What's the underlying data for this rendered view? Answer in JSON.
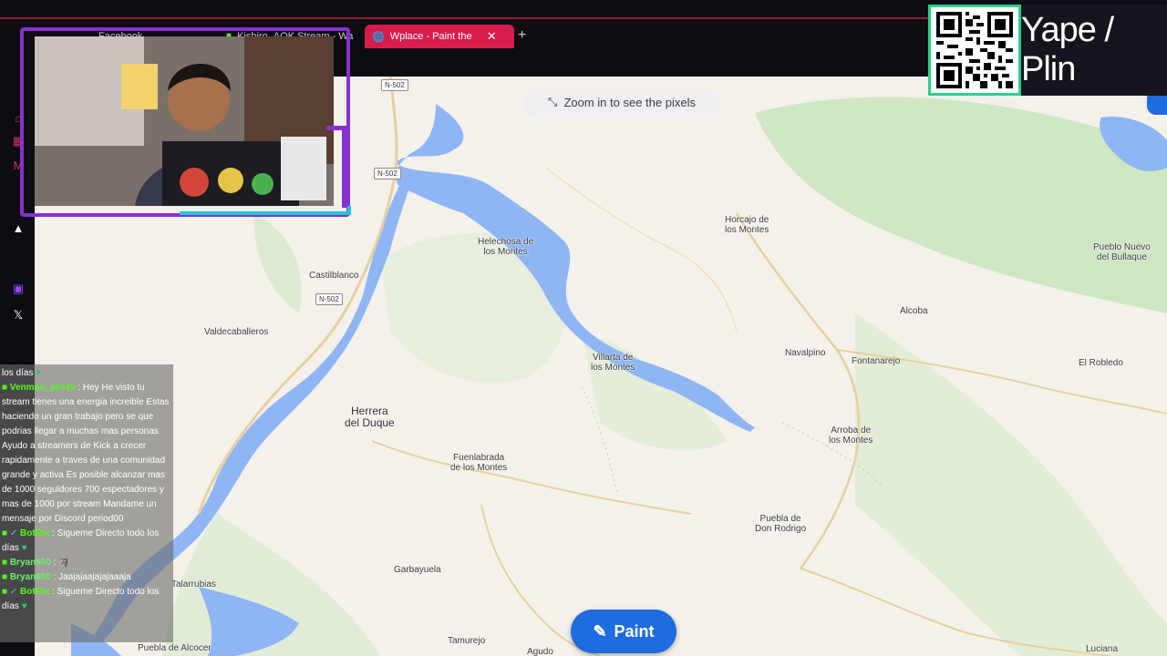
{
  "browser": {
    "tabs": [
      {
        "label": "Facebook",
        "active": false
      },
      {
        "label": "Kishiro_AOK Stream - Wa",
        "active": false
      },
      {
        "label": "Wplace - Paint the wo",
        "active": true
      }
    ],
    "new_tab_label": "+",
    "close_label": "✕"
  },
  "map": {
    "zoom_hint": "Zoom in to see the pixels",
    "paint_button": "Paint",
    "roads": [
      "N-502",
      "N-502",
      "N-502"
    ],
    "places": {
      "horcajo": [
        "Horcajo de",
        "los Montes"
      ],
      "helechosa": [
        "Helechosa de",
        "los Montes"
      ],
      "castilblanco": "Castilblanco",
      "valdecaballeros": "Valdecaballeros",
      "villarta": [
        "Villarta de",
        "los Montes"
      ],
      "herrera": [
        "Herrera",
        "del Duque"
      ],
      "fuenlabrada": [
        "Fuenlabrada",
        "de los Montes"
      ],
      "navalpino": "Navalpino",
      "fontanarejo": "Fontanarejo",
      "alcoba": "Alcoba",
      "pueblo_nuevo": [
        "Pueblo Nuevo",
        "del Bullaque"
      ],
      "el_robledo": "El Robledo",
      "arroba": [
        "Arroba de",
        "los Montes"
      ],
      "puebla_don_rodrigo": [
        "Puebla de",
        "Don Rodrigo"
      ],
      "garbayuela": "Garbayuela",
      "talarrubias": "Talarrubias",
      "puebla_alcocer": "Puebla de Alcocer",
      "tamurejo": "Tamurejo",
      "agudo": "Agudo",
      "luciana": "Luciana"
    }
  },
  "overlay": {
    "yape_label": "Yape / Plin"
  },
  "chat": {
    "messages": [
      {
        "user": "",
        "text": "los días"
      },
      {
        "user": "Venmon_pro45",
        "text": ": Hey He visto tu stream tienes una energia increible Estas haciendo un gran trabajo pero se que podrias llegar a muchas mas personas Ayudo a streamers de Kick a crecer rapidamente a traves de una comunidad grande y activa Es posible alcanzar mas de 1000 seguidores 700 espectadores y mas de 1000 por stream Mandame un mensaje por Discord period00"
      },
      {
        "user": "BotRix",
        "text": ": Sigueme Directo todo los días"
      },
      {
        "user": "Bryan900",
        "text": ":"
      },
      {
        "user": "Bryan900",
        "text": ": Jaajajaajajajaaaja"
      },
      {
        "user": "BotRix",
        "text": ": Sigueme Directo todo los días"
      }
    ]
  },
  "colors": {
    "accent_tab": "#d71d4e",
    "paint_button": "#1f6be0",
    "kick_green": "#53fc18",
    "water": "#8fb5f5"
  }
}
